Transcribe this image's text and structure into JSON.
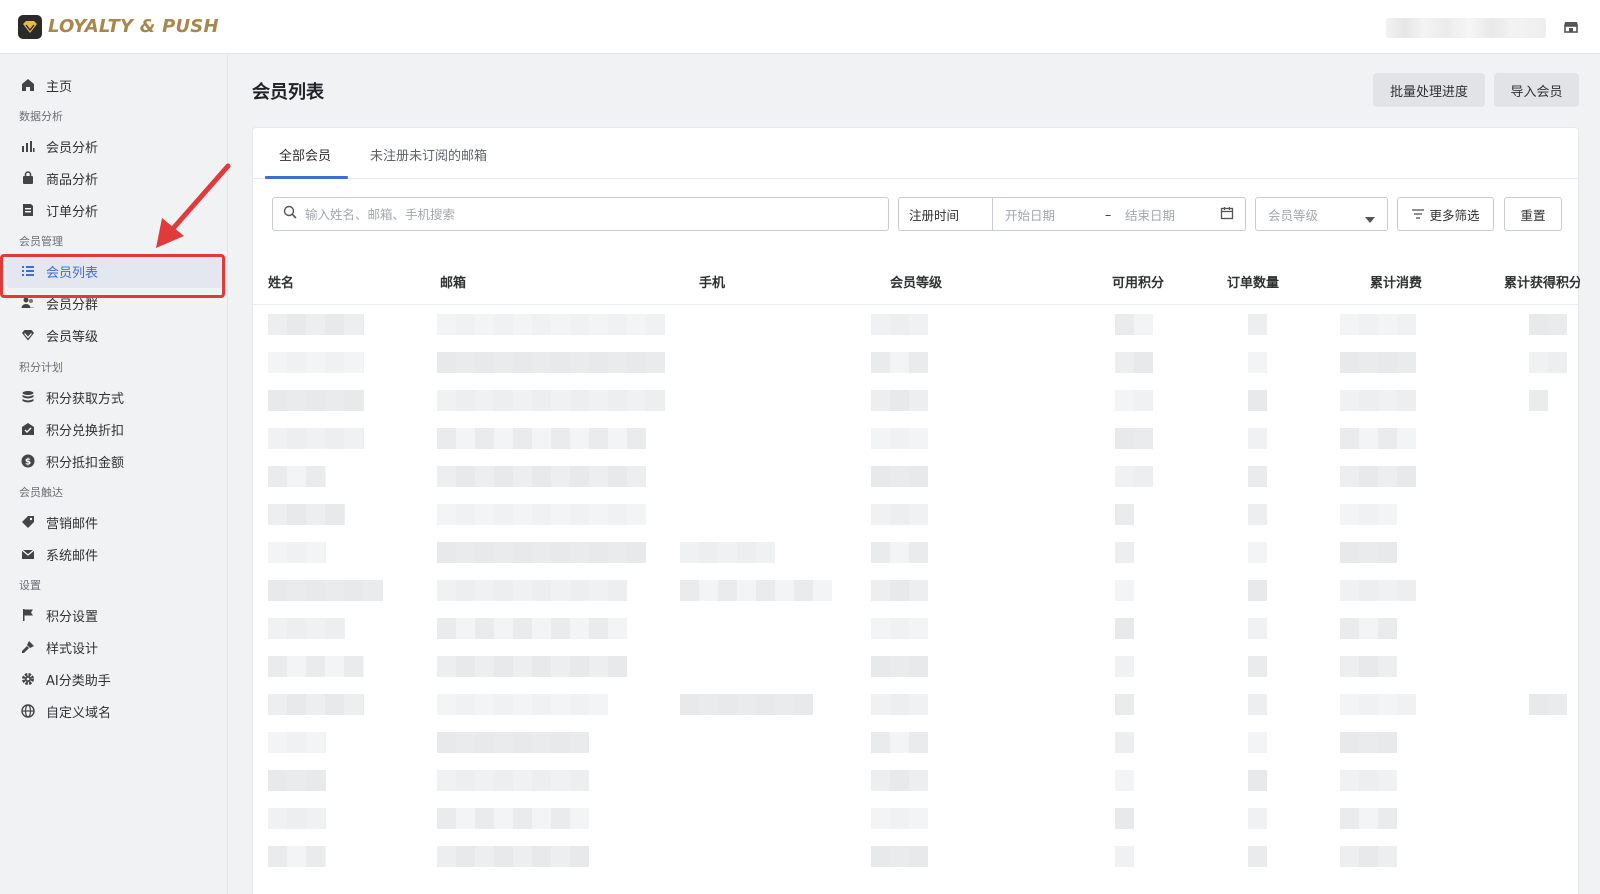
{
  "app": {
    "logo_text": "LOYALTY & PUSH"
  },
  "sidebar": {
    "home": "主页",
    "sections": {
      "analytics": "数据分析",
      "members": "会员管理",
      "points": "积分计划",
      "outreach": "会员触达",
      "settings": "设置"
    },
    "items": {
      "member_analysis": "会员分析",
      "product_analysis": "商品分析",
      "order_analysis": "订单分析",
      "member_list": "会员列表",
      "member_segments": "会员分群",
      "member_levels": "会员等级",
      "points_earn": "积分获取方式",
      "points_redeem": "积分兑换折扣",
      "points_deduct": "积分抵扣金额",
      "marketing_email": "营销邮件",
      "system_email": "系统邮件",
      "points_settings": "积分设置",
      "style_design": "样式设计",
      "ai_assistant": "AI分类助手",
      "custom_domain": "自定义域名"
    },
    "active_item": "member_list"
  },
  "main": {
    "title": "会员列表",
    "batch_button": "批量处理进度",
    "import_button": "导入会员",
    "tabs": [
      "全部会员",
      "未注册未订阅的邮箱"
    ],
    "active_tab": 0
  },
  "filters": {
    "search_placeholder": "输入姓名、邮箱、手机搜索",
    "date_label": "注册时间",
    "start_date_placeholder": "开始日期",
    "date_separator": "–",
    "end_date_placeholder": "结束日期",
    "level_placeholder": "会员等级",
    "more_filters": "更多筛选",
    "reset": "重置"
  },
  "table": {
    "columns": [
      "姓名",
      "邮箱",
      "手机",
      "会员等级",
      "可用积分",
      "订单数量",
      "累计消费",
      "累计获得积分"
    ],
    "row_count": 15
  },
  "colors": {
    "accent": "#3b6ddb",
    "annotation_red": "#e13a3a",
    "logo_gold": "#a8874f"
  }
}
